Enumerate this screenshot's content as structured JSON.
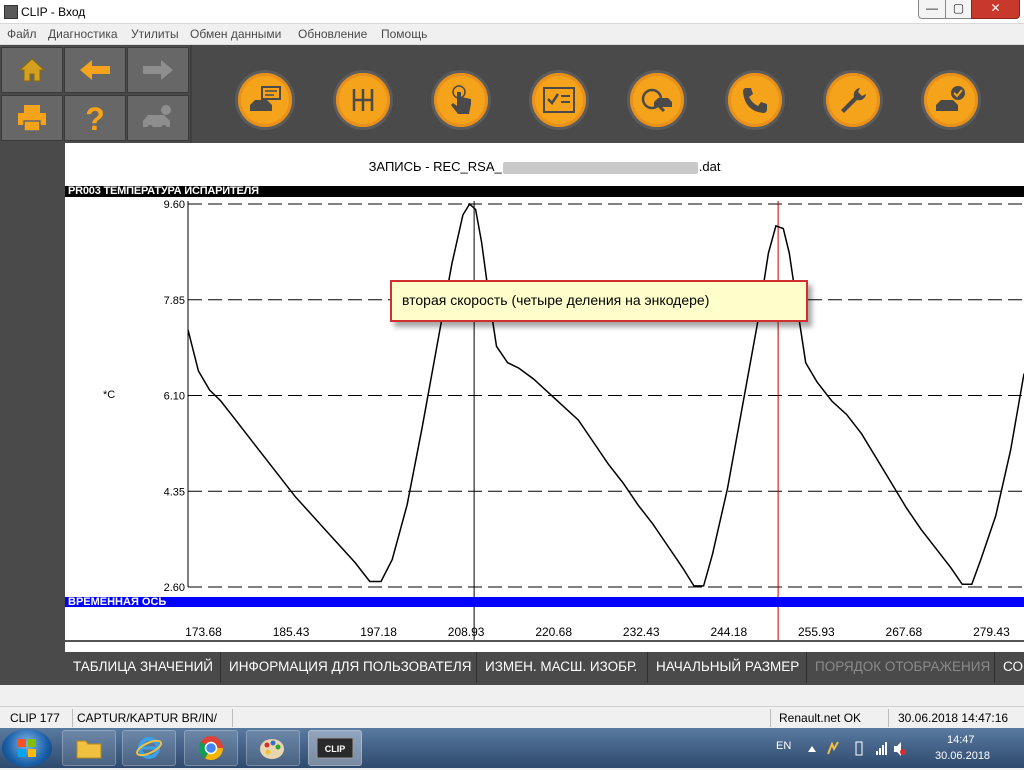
{
  "window": {
    "title": "CLIP - Вход",
    "minimize": "—",
    "maximize": "▢",
    "close": "✕"
  },
  "menu": [
    "Файл",
    "Диагностика",
    "Утилиты",
    "Обмен данными",
    "Обновление",
    "Помощь"
  ],
  "toolbar": {
    "nav": [
      {
        "icon": "home-icon",
        "color": "#d4a020"
      },
      {
        "icon": "back-arrow-icon",
        "color": "#f5a31a"
      },
      {
        "icon": "forward-arrow-icon",
        "color": "#8e8e8e"
      },
      {
        "icon": "printer-icon",
        "color": "#f5a31a"
      },
      {
        "icon": "help-icon",
        "color": "#f5a31a"
      },
      {
        "icon": "vehicle-info-icon",
        "color": "#8e8e8e"
      }
    ],
    "functions": [
      "vehicle-report-icon",
      "gearbox-icon",
      "touch-test-icon",
      "checklist-icon",
      "vehicle-scan-icon",
      "phone-support-icon",
      "wrench-icon",
      "vehicle-ok-icon"
    ],
    "accent": "#f5a31a"
  },
  "record": {
    "title_prefix": "ЗАПИСЬ - REC_RSA_",
    "title_suffix": ".dat"
  },
  "channel": {
    "label": "PR003  ТЕМПЕРАТУРА ИСПАРИТЕЛЯ",
    "unit": "*C"
  },
  "callout": {
    "text": "вторая скорость (четыре деления на энкодере)"
  },
  "time_axis": {
    "label": "ВРЕМЕННАЯ ОСЬ"
  },
  "chart_data": {
    "type": "line",
    "ylim": [
      2.6,
      9.6
    ],
    "xlim": [
      171.6,
      283.8
    ],
    "y_ticks": [
      "9.60",
      "7.85",
      "6.10",
      "4.35",
      "2.60"
    ],
    "x_ticks": [
      "173.68",
      "185.43",
      "197.18",
      "208.93",
      "220.68",
      "232.43",
      "244.18",
      "255.93",
      "267.68",
      "279.43"
    ],
    "grid": "dashed",
    "cursors": [
      {
        "x": 210.0,
        "color": "#000000"
      },
      {
        "x": 250.8,
        "color": "#c00000"
      }
    ],
    "series": [
      {
        "color": "#000000",
        "points": [
          [
            171.6,
            7.3
          ],
          [
            173.0,
            6.55
          ],
          [
            174.5,
            6.2
          ],
          [
            176.0,
            6.0
          ],
          [
            178.0,
            5.65
          ],
          [
            180.0,
            5.3
          ],
          [
            182.0,
            4.95
          ],
          [
            184.0,
            4.6
          ],
          [
            186.0,
            4.25
          ],
          [
            188.0,
            3.95
          ],
          [
            190.0,
            3.65
          ],
          [
            192.0,
            3.35
          ],
          [
            194.0,
            3.05
          ],
          [
            196.0,
            2.7
          ],
          [
            197.5,
            2.7
          ],
          [
            199.0,
            3.1
          ],
          [
            201.0,
            4.1
          ],
          [
            203.0,
            5.5
          ],
          [
            205.0,
            7.0
          ],
          [
            207.0,
            8.5
          ],
          [
            208.5,
            9.4
          ],
          [
            209.4,
            9.6
          ],
          [
            210.2,
            9.5
          ],
          [
            211.0,
            8.9
          ],
          [
            212.0,
            7.9
          ],
          [
            213.0,
            7.0
          ],
          [
            214.5,
            6.7
          ],
          [
            216.0,
            6.6
          ],
          [
            218.0,
            6.4
          ],
          [
            220.0,
            6.15
          ],
          [
            222.0,
            5.9
          ],
          [
            224.0,
            5.65
          ],
          [
            226.0,
            5.25
          ],
          [
            228.0,
            4.85
          ],
          [
            230.0,
            4.5
          ],
          [
            232.0,
            4.1
          ],
          [
            234.0,
            3.75
          ],
          [
            236.0,
            3.35
          ],
          [
            238.0,
            2.95
          ],
          [
            239.5,
            2.62
          ],
          [
            240.8,
            2.62
          ],
          [
            242.0,
            3.2
          ],
          [
            244.0,
            4.4
          ],
          [
            246.0,
            5.9
          ],
          [
            248.0,
            7.4
          ],
          [
            249.5,
            8.7
          ],
          [
            250.5,
            9.2
          ],
          [
            251.5,
            9.15
          ],
          [
            252.3,
            8.7
          ],
          [
            253.5,
            7.6
          ],
          [
            254.5,
            6.7
          ],
          [
            256.0,
            6.35
          ],
          [
            258.0,
            6.0
          ],
          [
            260.0,
            5.75
          ],
          [
            262.0,
            5.4
          ],
          [
            264.0,
            4.95
          ],
          [
            266.0,
            4.5
          ],
          [
            268.0,
            4.05
          ],
          [
            270.0,
            3.65
          ],
          [
            272.0,
            3.3
          ],
          [
            274.0,
            2.95
          ],
          [
            275.5,
            2.65
          ],
          [
            276.8,
            2.65
          ],
          [
            278.0,
            3.1
          ],
          [
            280.0,
            3.9
          ],
          [
            282.0,
            5.1
          ],
          [
            283.8,
            6.5
          ]
        ]
      }
    ]
  },
  "actions": [
    {
      "label": "ТАБЛИЦА ЗНАЧЕНИЙ",
      "enabled": true
    },
    {
      "label": "ИНФОРМАЦИЯ ДЛЯ ПОЛЬЗОВАТЕЛЯ",
      "enabled": true
    },
    {
      "label": "ИЗМЕН. МАСШ. ИЗОБР.",
      "enabled": true
    },
    {
      "label": "НАЧАЛЬНЫЙ РАЗМЕР",
      "enabled": true
    },
    {
      "label": "ПОРЯДОК ОТОБРАЖЕНИЯ",
      "enabled": false
    },
    {
      "label": "СО",
      "enabled": true
    }
  ],
  "status": {
    "version": "CLIP 177",
    "vehicle": "CAPTUR/KAPTUR BR/IN/",
    "network": "Renault.net OK",
    "datetime": "30.06.2018 14:47:16"
  },
  "taskbar": {
    "apps": [
      "file-explorer-icon",
      "internet-explorer-icon",
      "chrome-icon",
      "paint-icon",
      "clip-app-icon"
    ],
    "lang": "EN",
    "time": "14:47",
    "date": "30.06.2018"
  }
}
